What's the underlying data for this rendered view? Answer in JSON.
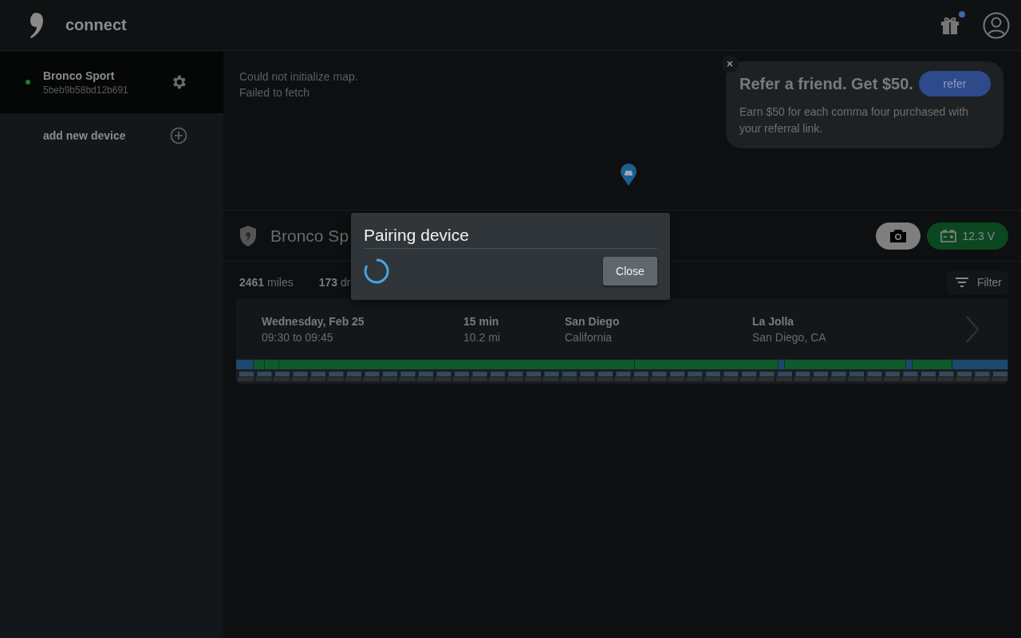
{
  "header": {
    "logo_text": "connect",
    "gift_has_notification": true
  },
  "devices": [
    {
      "name": "Bronco Sport",
      "id": "5beb9b58bd12b691",
      "online": true,
      "selected": true
    }
  ],
  "add_device": {
    "label": "add new device"
  },
  "map": {
    "errors": [
      "Could not initialize map.",
      "Failed to fetch"
    ]
  },
  "referral": {
    "title": "Refer a friend. Get $50.",
    "button": "refer",
    "text": "Earn $50 for each comma four purchased with your referral link."
  },
  "vehicle": {
    "name": "Bronco Sp",
    "voltage": "12.3 V"
  },
  "stats": [
    {
      "value": "2461",
      "unit": "miles"
    },
    {
      "value": "173",
      "unit": "dr"
    }
  ],
  "filter": {
    "label": "Filter"
  },
  "trips": [
    {
      "date": "Wednesday, Feb 25",
      "time": "09:30 to 09:45",
      "duration": "15 min",
      "distance": "10.2 mi",
      "start_city": "San Diego",
      "start_region": "California",
      "end_city": "La Jolla",
      "end_region": "San Diego, CA"
    }
  ],
  "dialog": {
    "title": "Pairing device",
    "button": "Close"
  }
}
